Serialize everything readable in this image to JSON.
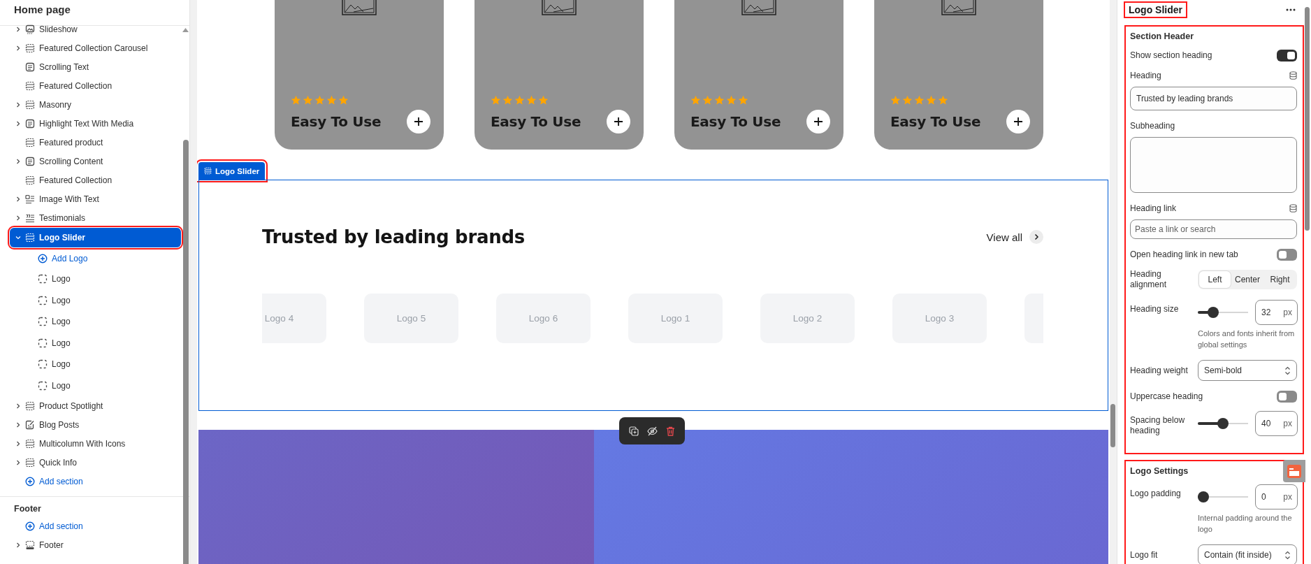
{
  "sidebar": {
    "title": "Home page",
    "items": [
      {
        "label": "Slideshow",
        "kind": "slideshow",
        "collapsible": true,
        "expanded": false,
        "selected": false,
        "highlighted": false
      },
      {
        "label": "Featured Collection Carousel",
        "kind": "section",
        "collapsible": true,
        "expanded": false,
        "selected": false,
        "highlighted": false
      },
      {
        "label": "Scrolling Text",
        "kind": "text",
        "collapsible": false,
        "selected": false,
        "highlighted": false
      },
      {
        "label": "Featured Collection",
        "kind": "section",
        "collapsible": false,
        "selected": false,
        "highlighted": false
      },
      {
        "label": "Masonry",
        "kind": "section",
        "collapsible": true,
        "expanded": false,
        "selected": false,
        "highlighted": false
      },
      {
        "label": "Highlight Text With Media",
        "kind": "text",
        "collapsible": true,
        "expanded": false,
        "selected": false,
        "highlighted": false
      },
      {
        "label": "Featured product",
        "kind": "section",
        "collapsible": false,
        "selected": false,
        "highlighted": false
      },
      {
        "label": "Scrolling Content",
        "kind": "text",
        "collapsible": true,
        "expanded": false,
        "selected": false,
        "highlighted": false
      },
      {
        "label": "Featured Collection",
        "kind": "section",
        "collapsible": false,
        "selected": false,
        "highlighted": false
      },
      {
        "label": "Image With Text",
        "kind": "image-text",
        "collapsible": true,
        "expanded": false,
        "selected": false,
        "highlighted": false
      },
      {
        "label": "Testimonials",
        "kind": "testimonials",
        "collapsible": true,
        "expanded": false,
        "selected": false,
        "highlighted": false
      },
      {
        "label": "Logo Slider",
        "kind": "section",
        "collapsible": true,
        "expanded": true,
        "selected": true,
        "highlighted": true,
        "children": [
          {
            "label": "Add Logo",
            "kind": "add"
          },
          {
            "label": "Logo",
            "kind": "block",
            "selected": false
          },
          {
            "label": "Logo",
            "kind": "block",
            "selected": false
          },
          {
            "label": "Logo",
            "kind": "block",
            "selected": false
          },
          {
            "label": "Logo",
            "kind": "block",
            "selected": false
          },
          {
            "label": "Logo",
            "kind": "block",
            "selected": false
          },
          {
            "label": "Logo",
            "kind": "block",
            "selected": false
          }
        ]
      },
      {
        "label": "Product Spotlight",
        "kind": "section",
        "collapsible": true,
        "expanded": false,
        "selected": false,
        "highlighted": false
      },
      {
        "label": "Blog Posts",
        "kind": "blog",
        "collapsible": true,
        "expanded": false,
        "selected": false,
        "highlighted": false
      },
      {
        "label": "Multicolumn With Icons",
        "kind": "section",
        "collapsible": true,
        "expanded": false,
        "selected": false,
        "highlighted": false
      },
      {
        "label": "Quick Info",
        "kind": "section",
        "collapsible": true,
        "expanded": false,
        "selected": false,
        "highlighted": false
      },
      {
        "label": "Add section",
        "kind": "add"
      }
    ],
    "groups": [
      {
        "title": "Footer",
        "items": [
          {
            "label": "Add section",
            "kind": "add"
          },
          {
            "label": "Footer",
            "kind": "footer",
            "collapsible": true,
            "expanded": false,
            "selected": false,
            "highlighted": false
          }
        ]
      }
    ]
  },
  "canvas": {
    "product_cards": [
      {
        "title": "Easy To Use",
        "stars": 5
      },
      {
        "title": "Easy To Use",
        "stars": 5
      },
      {
        "title": "Easy To Use",
        "stars": 5
      },
      {
        "title": "Easy To Use",
        "stars": 5
      }
    ],
    "logo_slider": {
      "tag": "Logo Slider",
      "tag_highlighted": true,
      "selected": true,
      "heading": "Trusted by leading brands",
      "view_all": "View all",
      "logos": [
        "Logo 4",
        "Logo 5",
        "Logo 6",
        "Logo 1",
        "Logo 2",
        "Logo 3"
      ]
    }
  },
  "panel": {
    "title": "Logo Slider",
    "highlighted": true,
    "sections": [
      {
        "title": "Section Header",
        "highlighted": true,
        "settings": [
          {
            "kind": "toggle",
            "label": "Show section heading",
            "on": true
          },
          {
            "kind": "text",
            "label": "Heading",
            "dynamic_source": true,
            "value": "Trusted by leading brands"
          },
          {
            "kind": "textarea",
            "label": "Subheading"
          },
          {
            "kind": "link",
            "label": "Heading link",
            "dynamic_source": true,
            "placeholder": "Paste a link or search"
          },
          {
            "kind": "toggle",
            "label": "Open heading link in new tab",
            "on": false
          },
          {
            "kind": "segmented",
            "label": "Heading alignment",
            "options": [
              {
                "label": "Left",
                "selected": true
              },
              {
                "label": "Center",
                "selected": false
              },
              {
                "label": "Right",
                "selected": false
              }
            ]
          },
          {
            "kind": "slider",
            "label": "Heading size",
            "level": 0.25,
            "value": "32",
            "unit": "px",
            "help": "Colors and fonts inherit from global settings"
          },
          {
            "kind": "select",
            "label": "Heading weight",
            "value": "Semi-bold"
          },
          {
            "kind": "toggle",
            "label": "Uppercase heading",
            "on": false
          },
          {
            "kind": "slider",
            "label": "Spacing below heading",
            "level": 0.5,
            "value": "40",
            "unit": "px"
          }
        ]
      },
      {
        "title": "Logo Settings",
        "highlighted": true,
        "settings": [
          {
            "kind": "slider",
            "label": "Logo padding",
            "level": 0,
            "value": "0",
            "unit": "px",
            "help": "Internal padding around the logo"
          },
          {
            "kind": "select",
            "label": "Logo fit",
            "value": "Contain (fit inside)"
          }
        ]
      }
    ]
  }
}
